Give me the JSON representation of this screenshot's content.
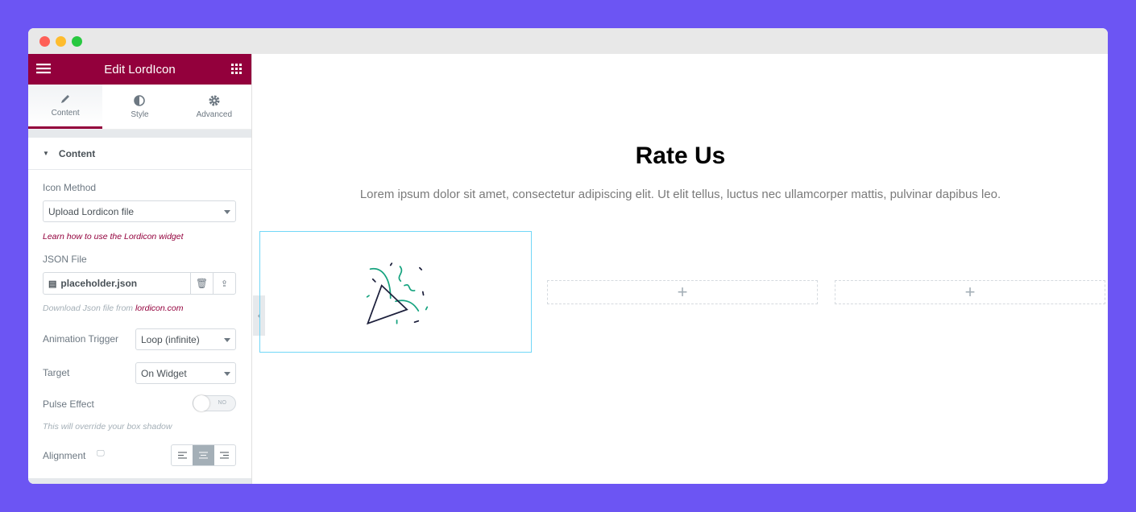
{
  "panel": {
    "title": "Edit LordIcon",
    "tabs": [
      {
        "label": "Content",
        "icon": "pencil-icon"
      },
      {
        "label": "Style",
        "icon": "half-circle-icon"
      },
      {
        "label": "Advanced",
        "icon": "gear-icon"
      }
    ],
    "section": "Content",
    "icon_method": {
      "label": "Icon Method",
      "value": "Upload Lordicon file"
    },
    "learn_link": "Learn how to use the Lordicon widget",
    "json_file": {
      "label": "JSON File",
      "value": "placeholder.json"
    },
    "download_note": "Download Json file from ",
    "download_link": "lordicon.com",
    "animation_trigger": {
      "label": "Animation Trigger",
      "value": "Loop (infinite)"
    },
    "target": {
      "label": "Target",
      "value": "On Widget"
    },
    "pulse": {
      "label": "Pulse Effect",
      "toggle": "NO",
      "note": "This will override your box shadow"
    },
    "alignment": {
      "label": "Alignment",
      "selected": "center"
    }
  },
  "canvas": {
    "heading": "Rate Us",
    "text": "Lorem ipsum dolor sit amet, consectetur adipiscing elit. Ut elit tellus, luctus nec ullamcorper mattis, pulvinar dapibus leo.",
    "add": "+"
  },
  "colors": {
    "brand": "#93003c",
    "background": "#6c55f3",
    "icon_accent": "#16a37f"
  }
}
